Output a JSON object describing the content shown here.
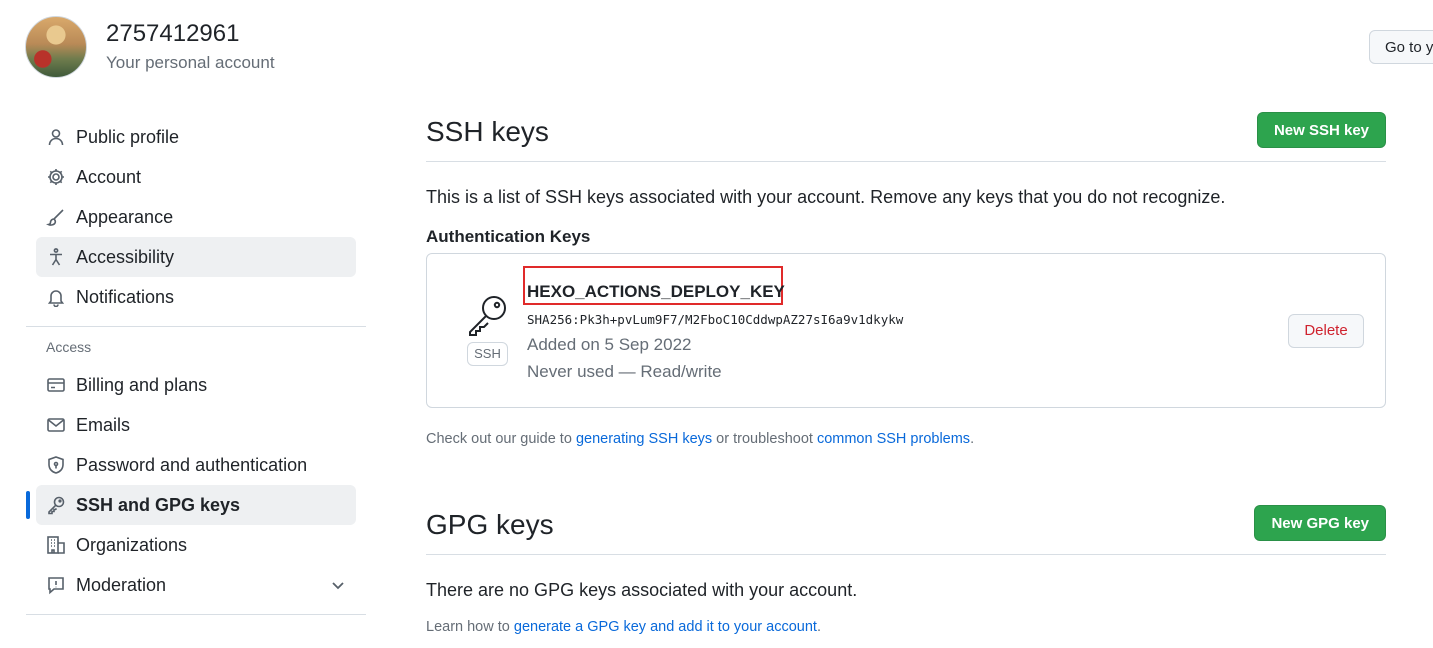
{
  "header": {
    "username": "2757412961",
    "subtitle": "Your personal account",
    "goto_button": "Go to y"
  },
  "sidebar": {
    "items": [
      {
        "label": "Public profile",
        "icon": "person-icon"
      },
      {
        "label": "Account",
        "icon": "gear-icon"
      },
      {
        "label": "Appearance",
        "icon": "paintbrush-icon"
      },
      {
        "label": "Accessibility",
        "icon": "accessibility-icon"
      },
      {
        "label": "Notifications",
        "icon": "bell-icon"
      }
    ],
    "access_label": "Access",
    "access_items": [
      {
        "label": "Billing and plans",
        "icon": "credit-card-icon"
      },
      {
        "label": "Emails",
        "icon": "mail-icon"
      },
      {
        "label": "Password and authentication",
        "icon": "shield-lock-icon"
      },
      {
        "label": "SSH and GPG keys",
        "icon": "key-icon"
      },
      {
        "label": "Organizations",
        "icon": "organization-icon"
      },
      {
        "label": "Moderation",
        "icon": "report-icon"
      }
    ]
  },
  "ssh": {
    "title": "SSH keys",
    "new_button": "New SSH key",
    "description": "This is a list of SSH keys associated with your account. Remove any keys that you do not recognize.",
    "auth_heading": "Authentication Keys",
    "key": {
      "badge": "SSH",
      "name": "HEXO_ACTIONS_DEPLOY_KEY",
      "fingerprint": "SHA256:Pk3h+pvLum9F7/M2FboC10CddwpAZ27sI6a9v1dkykw",
      "added": "Added on 5 Sep 2022",
      "usage": "Never used — Read/write",
      "delete_button": "Delete"
    },
    "help": {
      "prefix": "Check out our guide to ",
      "link1": "generating SSH keys",
      "middle": " or troubleshoot ",
      "link2": "common SSH problems",
      "suffix": "."
    }
  },
  "gpg": {
    "title": "GPG keys",
    "new_button": "New GPG key",
    "description": "There are no GPG keys associated with your account.",
    "help": {
      "prefix": "Learn how to ",
      "link": "generate a GPG key and add it to your account",
      "suffix": "."
    }
  },
  "colors": {
    "accent_green": "#2da44e",
    "link_blue": "#0969da",
    "danger_red": "#cf222e",
    "highlight_red": "#e02a2a"
  }
}
